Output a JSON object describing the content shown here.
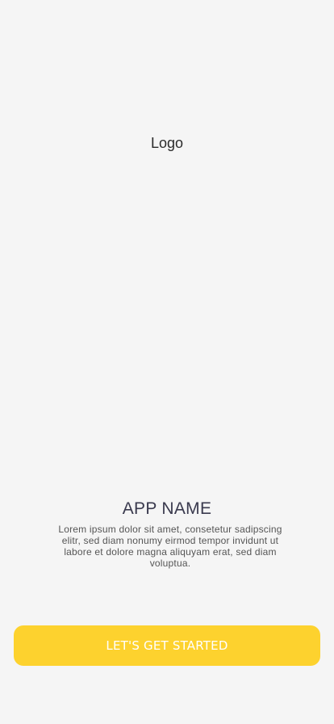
{
  "splash": {
    "logo_text": "Logo",
    "app_name": "APP NAME",
    "description": "Lorem ipsum dolor sit amet, consetetur sadipscing elitr, sed diam nonumy eirmod tempor invidunt ut labore et dolore magna aliquyam erat, sed diam voluptua.",
    "cta_label": "LET'S GET STARTED"
  },
  "colors": {
    "background": "#f5f5f5",
    "accent": "#fdd22e",
    "title": "#3a3a4e",
    "body_text": "#555555"
  }
}
